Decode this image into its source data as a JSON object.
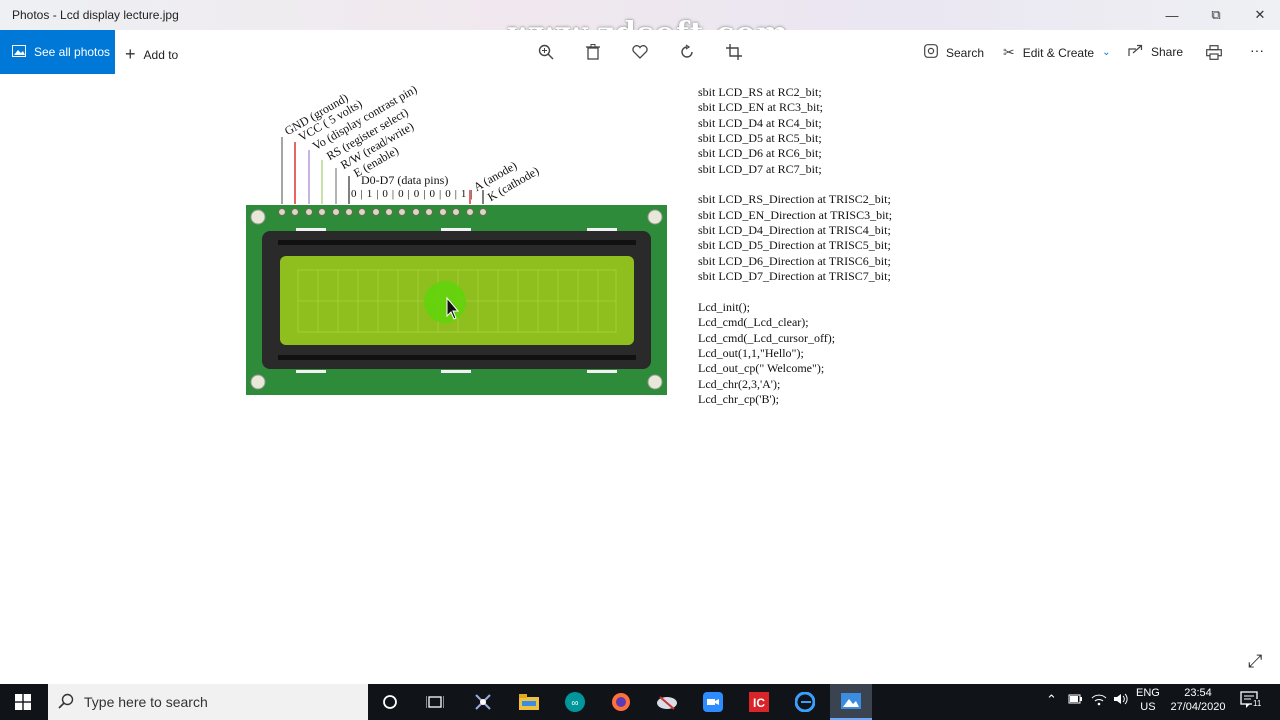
{
  "window": {
    "title": "Photos - Lcd display lecture.jpg",
    "watermark": "www.zdsoft.com",
    "controls": {
      "minimize": "—",
      "restore": "⧉",
      "close": "✕"
    }
  },
  "toolbar": {
    "see_all_photos": "See all photos",
    "add_to": "Add to",
    "search": "Search",
    "edit_create": "Edit & Create",
    "share": "Share",
    "more": "···"
  },
  "lcd": {
    "pin_labels": [
      "GND (ground)",
      "VCC ( 5 volts)",
      "Vo (display contrast pin)",
      "RS (register select)",
      "R/W (read/write)",
      "E (enable)"
    ],
    "data_pins_label": "D0-D7 (data pins)",
    "data_bits": "0|1|0|0|0|0|0|1|",
    "anode_label": "A (anode)",
    "cathode_label": "K (cathode)",
    "colors": {
      "board": "#2e8b3a",
      "frame": "#2a2a2a",
      "screen": "#8fbf1e",
      "cursor_glow": "#5fd40a"
    }
  },
  "code_lines": [
    "sbit LCD_RS at RC2_bit;",
    "sbit LCD_EN at RC3_bit;",
    "sbit LCD_D4 at RC4_bit;",
    "sbit LCD_D5 at RC5_bit;",
    "sbit LCD_D6 at RC6_bit;",
    "sbit LCD_D7 at RC7_bit;",
    "",
    "sbit LCD_RS_Direction at TRISC2_bit;",
    "sbit LCD_EN_Direction at TRISC3_bit;",
    "sbit LCD_D4_Direction at TRISC4_bit;",
    "sbit LCD_D5_Direction at TRISC5_bit;",
    "sbit LCD_D6_Direction at TRISC6_bit;",
    "sbit LCD_D7_Direction at TRISC7_bit;",
    "",
    "Lcd_init();",
    "Lcd_cmd(_Lcd_clear);",
    "Lcd_cmd(_Lcd_cursor_off);",
    "Lcd_out(1,1,\"Hello\");",
    "Lcd_out_cp(\" Welcome\");",
    "Lcd_chr(2,3,'A');",
    "Lcd_chr_cp('B');"
  ],
  "taskbar": {
    "search_placeholder": "Type here to search",
    "lang": "ENG",
    "region": "US",
    "time": "23:54",
    "date": "27/04/2020",
    "notification_count": "11"
  }
}
